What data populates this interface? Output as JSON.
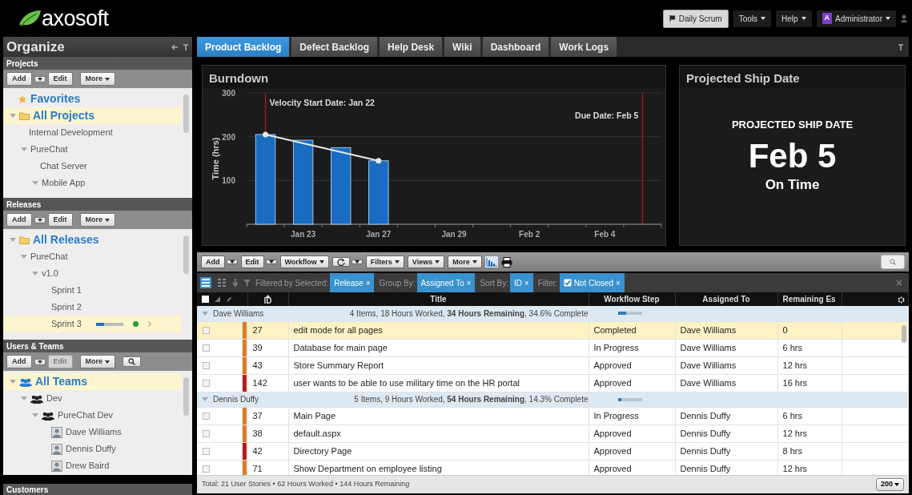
{
  "top_bar": {
    "logo": "axosoft",
    "buttons": [
      {
        "kind": "flag",
        "label": "Daily Scrum"
      },
      {
        "kind": "menu",
        "label": "Tools"
      },
      {
        "kind": "menu",
        "label": "Help"
      },
      {
        "kind": "user",
        "initial": "A",
        "label": "Administrator"
      }
    ]
  },
  "sidebar": {
    "title": "Organize",
    "sections": [
      {
        "title": "Projects",
        "buttons": [
          {
            "kind": "text",
            "label": "Add",
            "disabled": false
          },
          {
            "kind": "caret",
            "disabled": false
          },
          {
            "kind": "text",
            "label": "Edit",
            "disabled": false
          },
          {
            "kind": "menu",
            "label": "More",
            "disabled": false
          }
        ],
        "tree": [
          {
            "kind": "favorites",
            "label": "Favorites",
            "selected": false
          },
          {
            "kind": "folder",
            "label": "All Projects",
            "selected": true,
            "expanded": true,
            "children": [
              {
                "kind": "plain",
                "label": "Internal Development",
                "selected": false
              },
              {
                "kind": "plain",
                "label": "PureChat",
                "selected": false,
                "expanded": true,
                "children": [
                  {
                    "kind": "plain",
                    "label": "Chat Server",
                    "selected": false
                  },
                  {
                    "kind": "plain",
                    "label": "Mobile App",
                    "selected": false,
                    "expanded": true
                  }
                ]
              }
            ]
          }
        ]
      },
      {
        "title": "Releases",
        "buttons": [
          {
            "kind": "text",
            "label": "Add",
            "disabled": false
          },
          {
            "kind": "caret",
            "disabled": false
          },
          {
            "kind": "text",
            "label": "Edit",
            "disabled": false
          },
          {
            "kind": "menu",
            "label": "More",
            "disabled": false
          }
        ],
        "tree": [
          {
            "kind": "folder",
            "label": "All Releases",
            "selected": false,
            "expanded": true,
            "children": [
              {
                "kind": "plain",
                "label": "PureChat",
                "selected": false,
                "expanded": true,
                "children": [
                  {
                    "kind": "plain",
                    "label": "v1.0",
                    "selected": false,
                    "expanded": true,
                    "children": [
                      {
                        "kind": "sprint",
                        "label": "Sprint 1",
                        "selected": false
                      },
                      {
                        "kind": "sprint",
                        "label": "Sprint 2",
                        "selected": false
                      },
                      {
                        "kind": "sprint",
                        "label": "Sprint 3",
                        "selected": true,
                        "level": 0.3,
                        "color": "#2e9e2e"
                      }
                    ]
                  }
                ]
              }
            ]
          }
        ]
      },
      {
        "title": "Users & Teams",
        "buttons": [
          {
            "kind": "text",
            "label": "Add",
            "disabled": false
          },
          {
            "kind": "caret",
            "disabled": false
          },
          {
            "kind": "text",
            "label": "Edit",
            "disabled": true
          },
          {
            "kind": "menu",
            "label": "More",
            "disabled": false
          },
          {
            "kind": "search",
            "disabled": false
          }
        ],
        "tree": [
          {
            "kind": "team",
            "label": "All Teams",
            "selected": true,
            "expanded": true,
            "children": [
              {
                "kind": "team",
                "label": "Dev",
                "selected": false,
                "expanded": true,
                "children": [
                  {
                    "kind": "team",
                    "label": "PureChat Dev",
                    "selected": false,
                    "expanded": true,
                    "children": [
                      {
                        "kind": "user",
                        "label": "Dave Williams",
                        "selected": false
                      },
                      {
                        "kind": "user",
                        "label": "Dennis Duffy",
                        "selected": false
                      },
                      {
                        "kind": "user",
                        "label": "Drew Baird",
                        "selected": false
                      }
                    ]
                  }
                ]
              }
            ]
          }
        ]
      }
    ],
    "footer_section": "Customers"
  },
  "tabs": [
    {
      "label": "Product Backlog",
      "selected": true
    },
    {
      "label": "Defect Backlog",
      "selected": false
    },
    {
      "label": "Help Desk",
      "selected": false
    },
    {
      "label": "Wiki",
      "selected": false
    },
    {
      "label": "Dashboard",
      "selected": false
    },
    {
      "label": "Work Logs",
      "selected": false
    }
  ],
  "burndown": {
    "title": "Burndown",
    "chart_data": {
      "type": "bar",
      "ylabel": "Time (hrs)",
      "grid": true,
      "ylim": [
        0,
        300
      ],
      "yticks": [
        100,
        200,
        300
      ],
      "categories": [
        null,
        "Jan 23",
        null,
        "Jan 27",
        null,
        "Jan 29",
        null,
        "Feb 2",
        null,
        "Feb 4",
        null
      ],
      "series": [
        {
          "color": "#1a6cc0",
          "values": [
            205,
            192,
            175,
            145,
            null,
            null,
            null,
            null,
            null,
            null,
            null
          ]
        },
        {
          "type": "line",
          "marker": true,
          "color": "#e8e8e8",
          "values": [
            205,
            null,
            null,
            145,
            null,
            null,
            null,
            null,
            null,
            null,
            null
          ]
        }
      ],
      "annotations": [
        "Velocity Start Date: Jan 22",
        "Due Date: Feb 5"
      ]
    }
  },
  "projected": {
    "title": "Projected Ship Date",
    "heading": "PROJECTED SHIP DATE",
    "date": "Feb 5",
    "status": "On Time"
  },
  "toolbar": {
    "buttons": [
      {
        "kind": "split",
        "label": "Add"
      },
      {
        "kind": "split",
        "label": "Edit"
      },
      {
        "kind": "menu",
        "label": "Workflow"
      },
      {
        "kind": "refresh"
      },
      {
        "kind": "menu",
        "label": "Filters"
      },
      {
        "kind": "menu",
        "label": "Views"
      },
      {
        "kind": "menu",
        "label": "More"
      },
      {
        "kind": "chart"
      },
      {
        "kind": "print"
      }
    ]
  },
  "filter_bar": {
    "views": [
      {
        "kind": "list",
        "selected": true
      },
      {
        "kind": "grid",
        "selected": false
      }
    ],
    "items": [
      {
        "label": "Filtered by Selected:",
        "chip": "Release ×",
        "checkbox": false
      },
      {
        "label": "Group By:",
        "chip": "Assigned To ×",
        "checkbox": false
      },
      {
        "label": "Sort By:",
        "chip": "ID ×",
        "checkbox": false
      },
      {
        "label": "Filter:",
        "chip": "Not Closed ×",
        "checkbox": true
      }
    ],
    "close": "×"
  },
  "table": {
    "all_checked": false,
    "columns": [
      "ID",
      "Title",
      "Workflow Step",
      "Assigned To",
      "Remaining Es"
    ],
    "groups": [
      {
        "name": "Dave Williams",
        "expanded": true,
        "summary": "4 Items, 18 Hours Worked, **34 Hours Remaining**, 34.6% Complete",
        "level": 0.35,
        "rows": [
          {
            "checked": false,
            "selected": true,
            "color": "#e07b22",
            "id": "27",
            "title": "edit mode for all pages",
            "step": "Completed",
            "assigned": "Dave Williams",
            "remaining": "0"
          },
          {
            "checked": false,
            "selected": false,
            "color": "#e07b22",
            "id": "39",
            "title": "Database for main page",
            "step": "In Progress",
            "assigned": "Dave Williams",
            "remaining": "6 hrs"
          },
          {
            "checked": false,
            "selected": false,
            "color": "#e07b22",
            "id": "43",
            "title": "Store Summary Report",
            "step": "Approved",
            "assigned": "Dave Williams",
            "remaining": "12 hrs"
          },
          {
            "checked": false,
            "selected": false,
            "color": "#c0171b",
            "id": "142",
            "title": "user wants to be able to use military time on the HR portal",
            "step": "Approved",
            "assigned": "Dave Williams",
            "remaining": "16 hrs"
          }
        ]
      },
      {
        "name": "Dennis Duffy",
        "expanded": true,
        "summary": "5 Items, 9 Hours Worked, **54 Hours Remaining**, 14.3% Complete",
        "level": 0.14,
        "rows": [
          {
            "checked": false,
            "selected": false,
            "color": "#e07b22",
            "id": "37",
            "title": "Main Page",
            "step": "In Progress",
            "assigned": "Dennis Duffy",
            "remaining": "6 hrs"
          },
          {
            "checked": false,
            "selected": false,
            "color": "#e07b22",
            "id": "38",
            "title": "default.aspx",
            "step": "Approved",
            "assigned": "Dennis Duffy",
            "remaining": "12 hrs"
          },
          {
            "checked": false,
            "selected": false,
            "color": "#c0171b",
            "id": "42",
            "title": "Directory Page",
            "step": "Approved",
            "assigned": "Dennis Duffy",
            "remaining": "8 hrs"
          },
          {
            "checked": false,
            "selected": false,
            "color": "#e07b22",
            "id": "71",
            "title": "Show Department on employee listing",
            "step": "Approved",
            "assigned": "Dennis Duffy",
            "remaining": "12 hrs"
          }
        ]
      }
    ],
    "footer": {
      "summary": "Total: 21 User Stories • 62 Hours Worked • 144 Hours Remaining",
      "page_size": "200"
    }
  }
}
